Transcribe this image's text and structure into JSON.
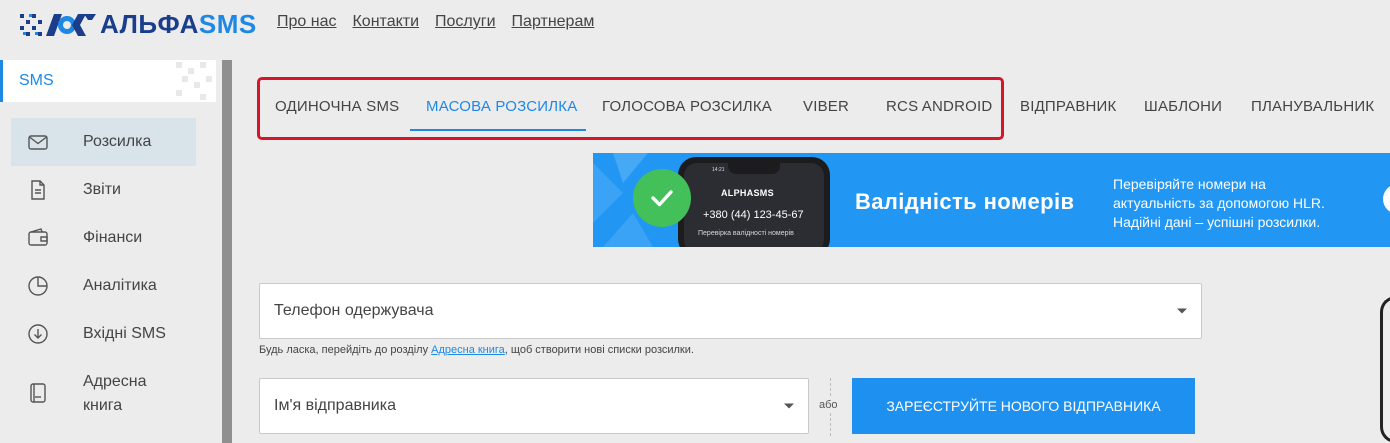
{
  "brand": {
    "alpha": "АЛЬФА",
    "sms": "SMS"
  },
  "topnav": [
    {
      "label": "Про нас"
    },
    {
      "label": "Контакти"
    },
    {
      "label": "Послуги"
    },
    {
      "label": "Партнерам"
    }
  ],
  "sidebar": {
    "section": "SMS",
    "items": [
      {
        "label": "Розсилка",
        "icon": "envelope-icon",
        "active": true
      },
      {
        "label": "Звіти",
        "icon": "document-icon"
      },
      {
        "label": "Фінанси",
        "icon": "wallet-icon"
      },
      {
        "label": "Аналітика",
        "icon": "pie-chart-icon"
      },
      {
        "label": "Вхідні SMS",
        "icon": "inbox-download-icon"
      },
      {
        "label": "Адресна",
        "label2": "книга",
        "icon": "address-book-icon"
      }
    ]
  },
  "tabs": [
    {
      "label": "Одиночна SMS"
    },
    {
      "label": "Масова розсилка",
      "active": true
    },
    {
      "label": "Голосова розсилка"
    },
    {
      "label": "Viber"
    },
    {
      "label": "RCS Android"
    },
    {
      "label": "Відправник"
    },
    {
      "label": "Шаблони"
    },
    {
      "label": "Планувальник"
    }
  ],
  "banner": {
    "phone_logo": "ALPHASMS",
    "phone_time": "14:21",
    "phone_number": "+380 (44) 123-45-67",
    "phone_caption": "Перевірка валідності номерів",
    "title": "Валідність номерів",
    "text_lines": [
      "Перевіряйте номери на",
      "актуальність за допомогою HLR.",
      "Надійні дані – успішні розсилки."
    ]
  },
  "form": {
    "recipient_value": "Телефон одержувача",
    "hint_before": "Будь ласка, перейдіть до розділу ",
    "hint_link": "Адресна книга",
    "hint_after": ", щоб створити нові списки розсилки.",
    "sender_value": "Ім'я відправника",
    "or_label": "або",
    "register_button": "Зареєструйте нового відправника"
  },
  "colors": {
    "accent": "#1e88e5",
    "highlight": "#d7152a",
    "banner": "#2196f3",
    "check": "#43c05a"
  }
}
